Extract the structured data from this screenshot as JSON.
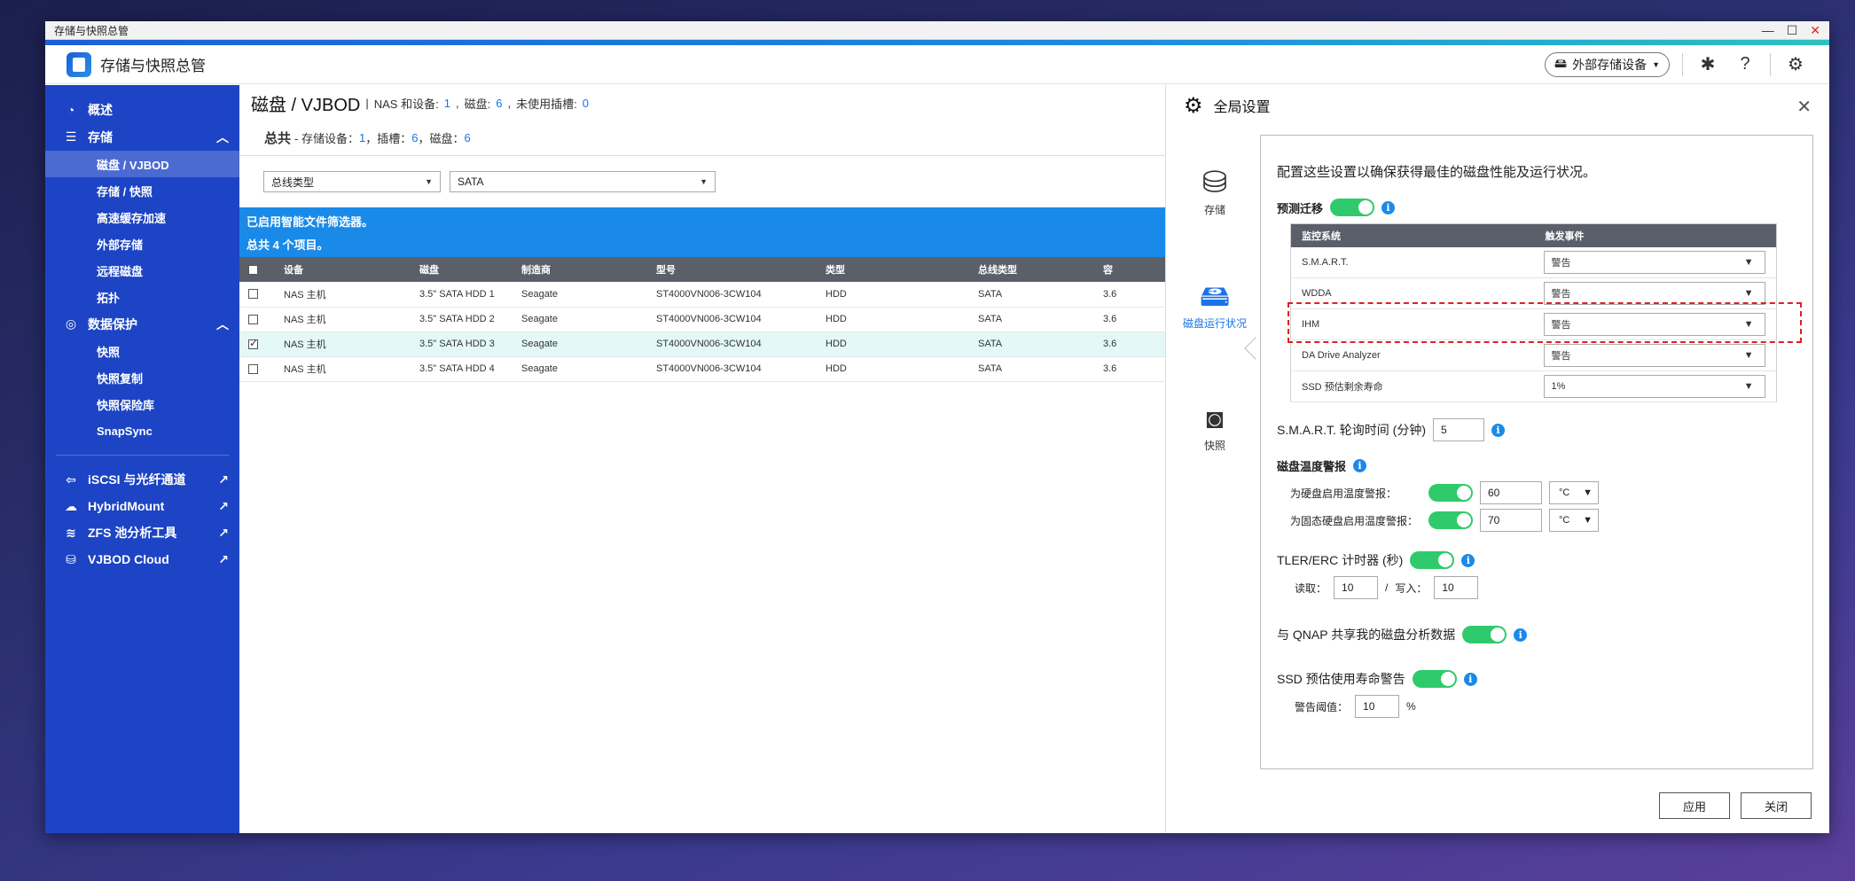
{
  "window": {
    "title": "存储与快照总管"
  },
  "header": {
    "app_name": "存储与快照总管",
    "external_storage_label": "外部存储设备"
  },
  "sidebar": {
    "overview": "概述",
    "storage": {
      "label": "存储",
      "items": [
        "磁盘 / VJBOD",
        "存储 / 快照",
        "高速缓存加速",
        "外部存储",
        "远程磁盘",
        "拓扑"
      ]
    },
    "protection": {
      "label": "数据保护",
      "items": [
        "快照",
        "快照复制",
        "快照保险库",
        "SnapSync"
      ]
    },
    "links": [
      "iSCSI 与光纤通道",
      "HybridMount",
      "ZFS 池分析工具",
      "VJBOD Cloud"
    ]
  },
  "main": {
    "title": "磁盘 / VJBOD",
    "title_stats": {
      "nas_label": "NAS 和设备:",
      "nas_value": "1",
      "disk_label": "磁盘:",
      "disk_value": "6",
      "slot_label": "未使用插槽:",
      "slot_value": "0"
    },
    "summary": {
      "label": "总共",
      "devices_label": "- 存储设备：",
      "devices": "1",
      "slots_label": "，插槽：",
      "slots": "6",
      "disks_label": "，磁盘：",
      "disks": "6"
    },
    "filter_type": "总线类型",
    "filter_value": "SATA",
    "banner_line1": "已启用智能文件筛选器。",
    "banner_line2": "总共 4 个项目。",
    "columns": [
      "设备",
      "磁盘",
      "制造商",
      "型号",
      "类型",
      "总线类型",
      "容"
    ],
    "rows": [
      {
        "device": "NAS 主机",
        "disk": "3.5\" SATA HDD 1",
        "maker": "Seagate",
        "model": "ST4000VN006-3CW104",
        "type": "HDD",
        "bus": "SATA",
        "cap": "3.6",
        "checked": false
      },
      {
        "device": "NAS 主机",
        "disk": "3.5\" SATA HDD 2",
        "maker": "Seagate",
        "model": "ST4000VN006-3CW104",
        "type": "HDD",
        "bus": "SATA",
        "cap": "3.6",
        "checked": false
      },
      {
        "device": "NAS 主机",
        "disk": "3.5\" SATA HDD 3",
        "maker": "Seagate",
        "model": "ST4000VN006-3CW104",
        "type": "HDD",
        "bus": "SATA",
        "cap": "3.6",
        "checked": true
      },
      {
        "device": "NAS 主机",
        "disk": "3.5\" SATA HDD 4",
        "maker": "Seagate",
        "model": "ST4000VN006-3CW104",
        "type": "HDD",
        "bus": "SATA",
        "cap": "3.6",
        "checked": false
      }
    ]
  },
  "panel": {
    "title": "全局设置",
    "categories": [
      "存储",
      "磁盘运行状况",
      "快照"
    ],
    "intro": "配置这些设置以确保获得最佳的磁盘性能及运行状况。",
    "predictive_migration": "预测迁移",
    "monitor_columns": [
      "监控系统",
      "触发事件"
    ],
    "monitor_rows": [
      {
        "system": "S.M.A.R.T.",
        "event": "警告"
      },
      {
        "system": "WDDA",
        "event": "警告"
      },
      {
        "system": "IHM",
        "event": "警告"
      },
      {
        "system": "DA Drive Analyzer",
        "event": "警告"
      },
      {
        "system": "SSD 预估剩余寿命",
        "event": "1%"
      }
    ],
    "smart_poll_label": "S.M.A.R.T. 轮询时间 (分钟)",
    "smart_poll_value": "5",
    "temp_alert_label": "磁盘温度警报",
    "hdd_temp_label": "为硬盘启用温度警报：",
    "hdd_temp_value": "60",
    "ssd_temp_label": "为固态硬盘启用温度警报：",
    "ssd_temp_value": "70",
    "temp_unit": "°C",
    "tler_label": "TLER/ERC 计时器 (秒)",
    "read_label": "读取：",
    "read_value": "10",
    "write_sep": "/",
    "write_label": "写入：",
    "write_value": "10",
    "share_label": "与 QNAP 共享我的磁盘分析数据",
    "ssd_warn_label": "SSD 预估使用寿命警告",
    "threshold_label": "警告阈值：",
    "threshold_value": "10",
    "threshold_unit": "%",
    "apply_label": "应用",
    "close_label": "关闭"
  },
  "colors": {
    "sidebar": "#1c44c4",
    "accent": "#1a8ae8",
    "toggle_on": "#2fca6b",
    "highlight": "#e02020"
  }
}
